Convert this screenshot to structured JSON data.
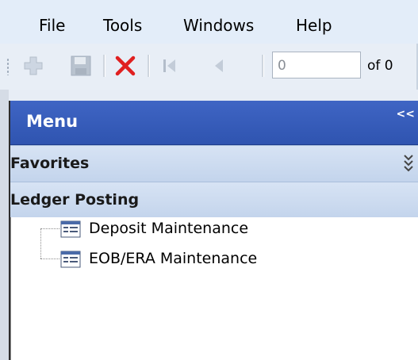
{
  "menubar": {
    "items": [
      {
        "label": "File"
      },
      {
        "label": "Tools"
      },
      {
        "label": "Windows"
      },
      {
        "label": "Help"
      }
    ]
  },
  "toolbar": {
    "buttons": [
      {
        "icon": "add-icon"
      },
      {
        "icon": "save-icon"
      },
      {
        "icon": "delete-icon"
      },
      {
        "icon": "first-record-icon"
      },
      {
        "icon": "previous-record-icon"
      }
    ],
    "record_value": "0",
    "record_of": "of 0"
  },
  "panel": {
    "title": "Menu",
    "collapse_label": "<<",
    "sections": [
      {
        "label": "Favorites"
      },
      {
        "label": "Ledger Posting"
      }
    ],
    "tree": [
      {
        "label": "Deposit Maintenance",
        "icon": "form-icon"
      },
      {
        "label": "EOB/ERA Maintenance",
        "icon": "form-icon"
      }
    ]
  },
  "colors": {
    "panel_header": "#3f65c4",
    "section_bg": "#d7e3f4",
    "menubar_bg": "#e3edf9",
    "delete_red": "#e02020"
  }
}
